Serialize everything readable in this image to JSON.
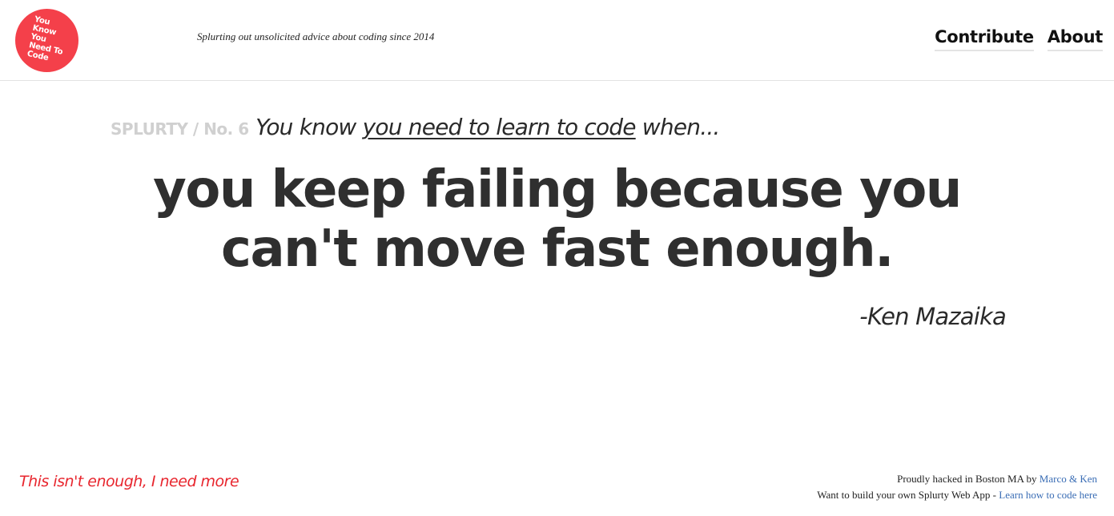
{
  "header": {
    "logo_text": "You Know You Need To Code",
    "logo_color": "#f4404a",
    "tagline": "Splurting out unsolicited advice about coding since 2014",
    "nav": [
      {
        "label": "Contribute"
      },
      {
        "label": "About"
      }
    ]
  },
  "main": {
    "splurty_label": "SPLURTY / No. 6",
    "lead_prefix": "You know ",
    "lead_link": "you need to learn to code",
    "lead_suffix": " when...",
    "quote_line1": "you keep failing because you",
    "quote_line2": "can't move fast enough.",
    "author": "-Ken Mazaika"
  },
  "footer": {
    "more_link": "This isn't enough, I need more",
    "credit_prefix": "Proudly hacked in Boston MA by ",
    "credit_link": "Marco & Ken",
    "build_prefix": "Want to build your own Splurty Web App - ",
    "build_link": "Learn how to code here",
    "accent_red": "#e8262e",
    "link_blue": "#3a6db5"
  }
}
